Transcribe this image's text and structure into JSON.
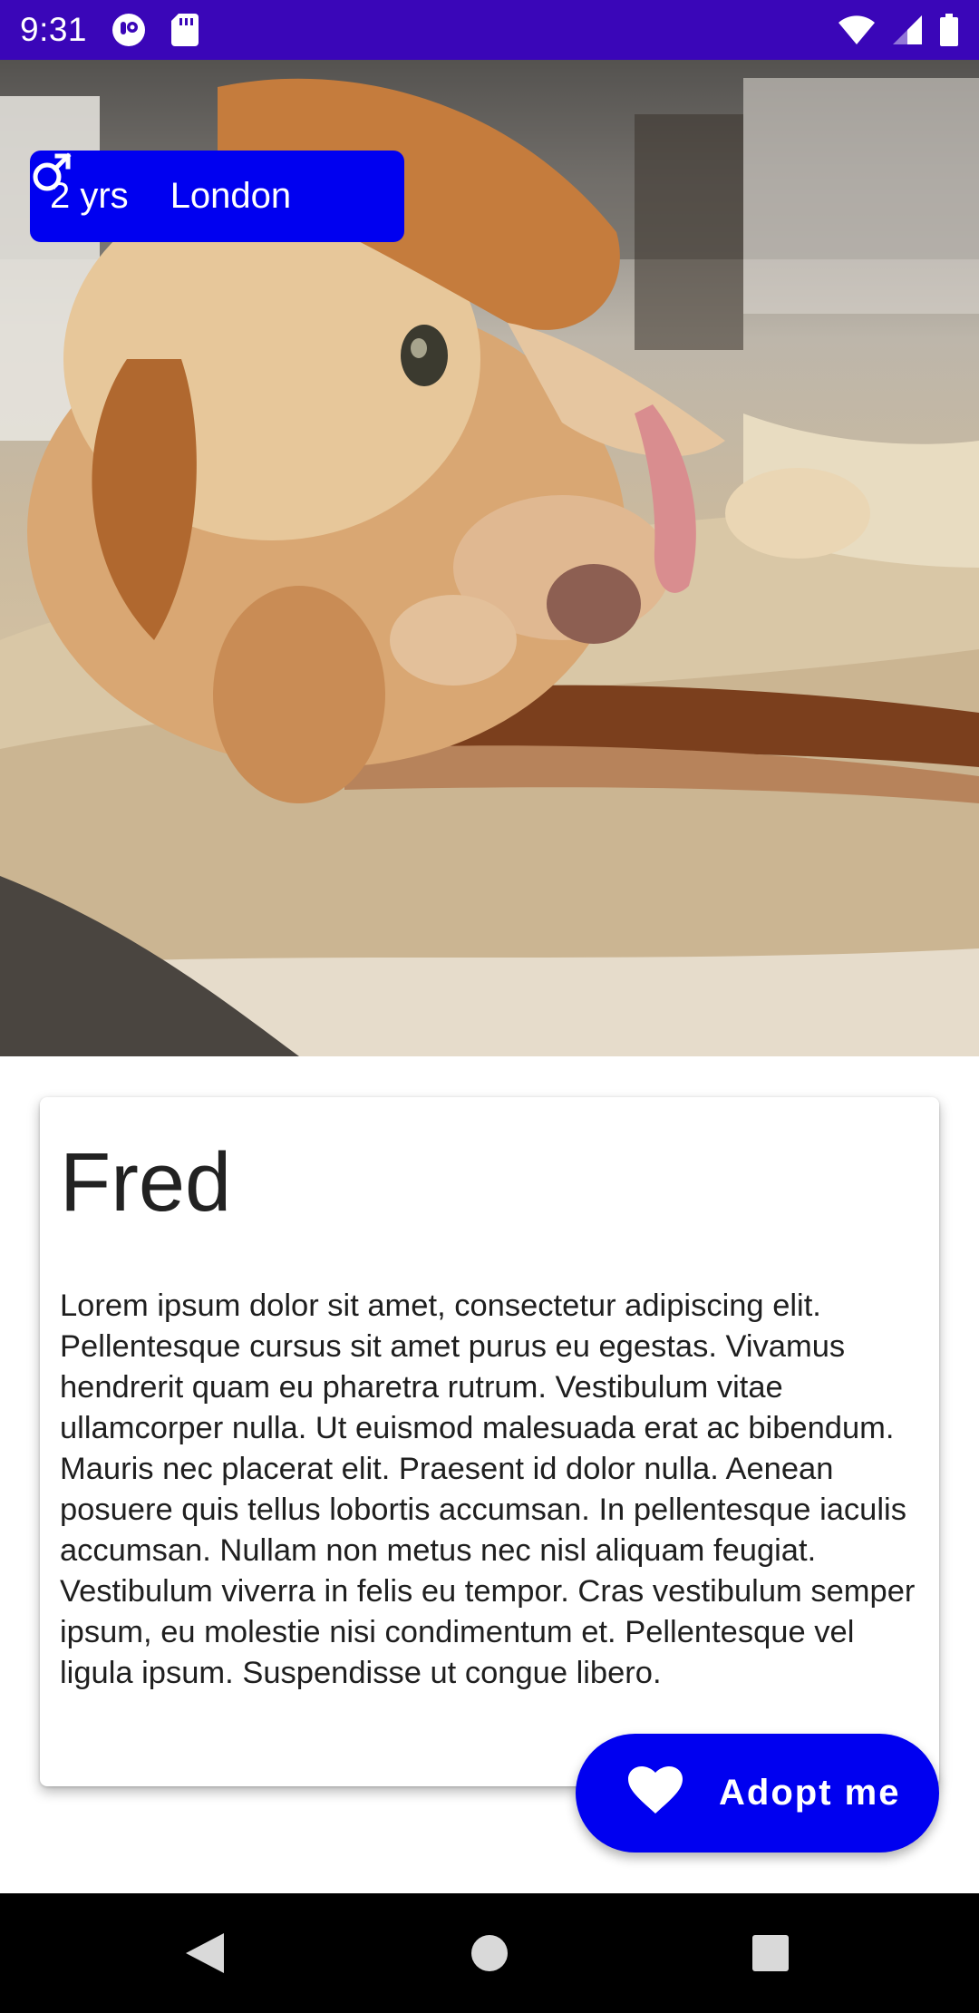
{
  "status_bar": {
    "time": "9:31",
    "icons": [
      "notification-app-icon",
      "sd-card-icon",
      "wifi-icon",
      "cellular-signal-icon",
      "battery-icon"
    ],
    "background_color": "#3a06b8"
  },
  "hero": {
    "image_description_icon": "dog-photo"
  },
  "info_chip": {
    "age": "2 yrs",
    "location": "London",
    "gender_icon": "male-icon",
    "color": "#0000f0"
  },
  "pet": {
    "name": "Fred",
    "description": "Lorem ipsum dolor sit amet, consectetur adipiscing elit. Pellentesque cursus sit amet purus eu egestas. Vivamus hendrerit quam eu pharetra rutrum. Vestibulum vitae ullamcorper nulla. Ut euismod malesuada erat ac bibendum. Mauris nec placerat elit. Praesent id dolor nulla. Aenean posuere quis tellus lobortis accumsan. In pellentesque iaculis accumsan. Nullam non metus nec nisl aliquam feugiat. Vestibulum viverra in felis eu tempor. Cras vestibulum semper ipsum, eu molestie nisi condimentum et. Pellentesque vel ligula ipsum. Suspendisse ut congue libero."
  },
  "adopt_button": {
    "label": "Adopt me",
    "icon": "heart-icon",
    "color": "#0000f0"
  },
  "nav_bar": {
    "buttons": [
      "back-icon",
      "home-icon",
      "recents-icon"
    ]
  }
}
